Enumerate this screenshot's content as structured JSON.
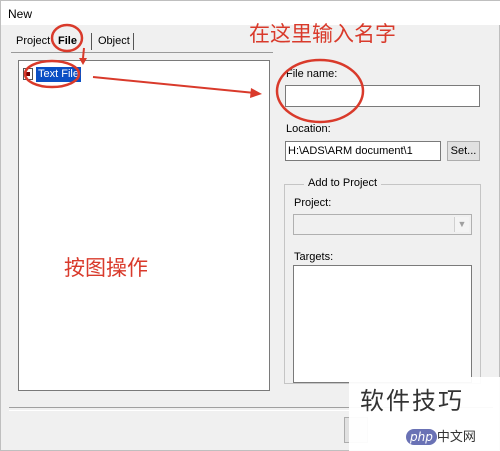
{
  "window": {
    "title": "New"
  },
  "tabs": [
    {
      "label": "Project"
    },
    {
      "label": "File"
    },
    {
      "label": "Object"
    }
  ],
  "file_types": [
    {
      "label": "Text File",
      "icon": "text-file-icon",
      "selected": true
    }
  ],
  "file_name": {
    "label": "File name:",
    "value": ""
  },
  "location": {
    "label": "Location:",
    "value": "H:\\ADS\\ARM document\\1",
    "browse_label": "Set..."
  },
  "add_to_project": {
    "group_label": "Add to Project",
    "project_label": "Project:",
    "project_value": "",
    "targets_label": "Targets:"
  },
  "annotations": {
    "enter_name": "在这里输入名字",
    "follow_figure": "按图操作",
    "color": "#d93a2b"
  },
  "watermark": {
    "text": "软件技巧",
    "logo_brand": "php",
    "logo_site": "中文网"
  }
}
